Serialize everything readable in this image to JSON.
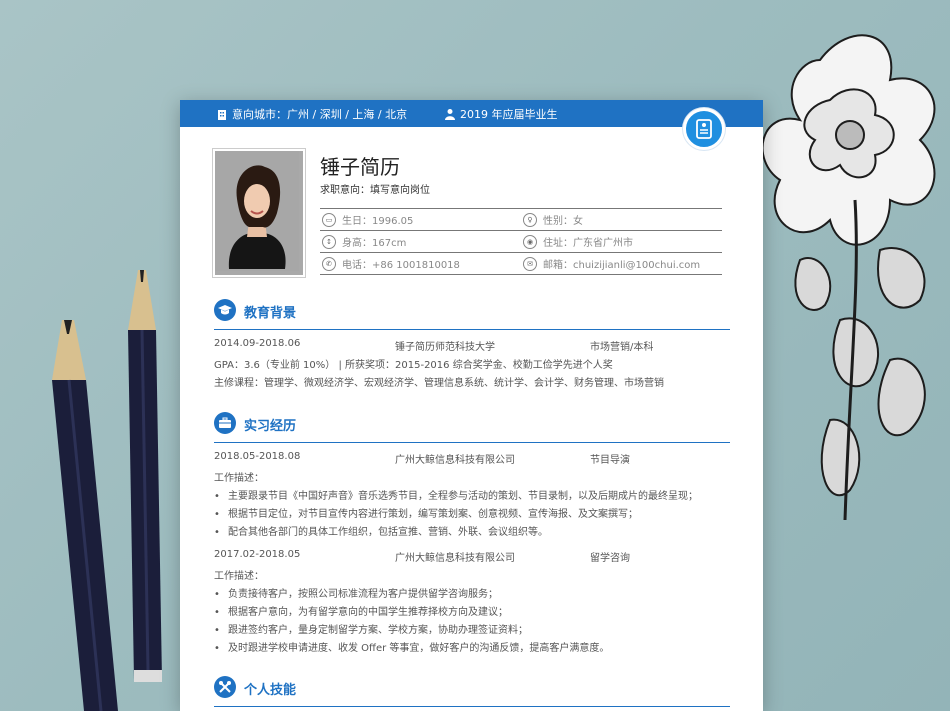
{
  "header": {
    "city_label": "意向城市：广州 / 深圳 / 上海 / 北京",
    "grad_label": "2019 年应届毕业生"
  },
  "profile": {
    "name": "锤子简历",
    "intent": "求职意向：填写意向岗位",
    "info": [
      {
        "icon": "birthday-icon",
        "text": "生日：1996.05"
      },
      {
        "icon": "gender-icon",
        "text": "性别：女"
      },
      {
        "icon": "height-icon",
        "text": "身高：167cm"
      },
      {
        "icon": "location-icon",
        "text": "住址：广东省广州市"
      },
      {
        "icon": "phone-icon",
        "text": "电话：+86 1001810018"
      },
      {
        "icon": "email-icon",
        "text": "邮箱：chuizijianli@100chui.com"
      }
    ]
  },
  "education": {
    "title": "教育背景",
    "period": "2014.09-2018.06",
    "school": "锤子简历师范科技大学",
    "major": "市场营销/本科",
    "gpa": "GPA：3.6（专业前 10%） | 所获奖项：2015-2016 综合奖学金、校勤工俭学先进个人奖",
    "courses": "主修课程：管理学、微观经济学、宏观经济学、管理信息系统、统计学、会计学、财务管理、市场营销"
  },
  "internship": {
    "title": "实习经历",
    "jobs": [
      {
        "period": "2018.05-2018.08",
        "company": "广州大鲸信息科技有限公司",
        "role": "节目导演",
        "desc_label": "工作描述：",
        "bullets": [
          "主要跟录节目《中国好声音》音乐选秀节目，全程参与活动的策划、节目录制，以及后期成片的最终呈现；",
          "根据节目定位，对节目宣传内容进行策划，编写策划案、创意视频、宣传海报、及文案撰写；",
          "配合其他各部门的具体工作组织，包括宣推、营销、外联、会议组织等。"
        ]
      },
      {
        "period": "2017.02-2018.05",
        "company": "广州大鲸信息科技有限公司",
        "role": "留学咨询",
        "desc_label": "工作描述：",
        "bullets": [
          "负责接待客户，按照公司标准流程为客户提供留学咨询服务；",
          "根据客户意向，为有留学意向的中国学生推荐择校方向及建议；",
          "跟进签约客户，量身定制留学方案、学校方案，协助办理签证资料；",
          "及时跟进学校申请进度、收发 Offer 等事宜，做好客户的沟通反馈，提高客户满意度。"
        ]
      }
    ]
  },
  "skills": {
    "title": "个人技能"
  },
  "colors": {
    "accent": "#1f72c3"
  }
}
